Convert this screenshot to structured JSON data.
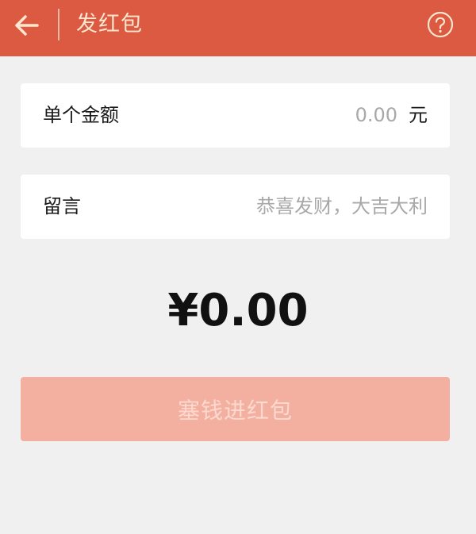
{
  "header": {
    "title": "发红包",
    "back_icon": "arrow-left-icon",
    "help_icon": "question-circle-icon",
    "background_color": "#db5a41",
    "text_color": "#fde6cf"
  },
  "amount_row": {
    "label": "单个金额",
    "placeholder": "0.00",
    "value": "",
    "unit": "元"
  },
  "message_row": {
    "label": "留言",
    "placeholder": "恭喜发财，大吉大利",
    "value": ""
  },
  "total": {
    "display": "¥0.00"
  },
  "submit": {
    "label": "塞钱进红包",
    "enabled": false,
    "background_color": "#f3b0a0"
  }
}
